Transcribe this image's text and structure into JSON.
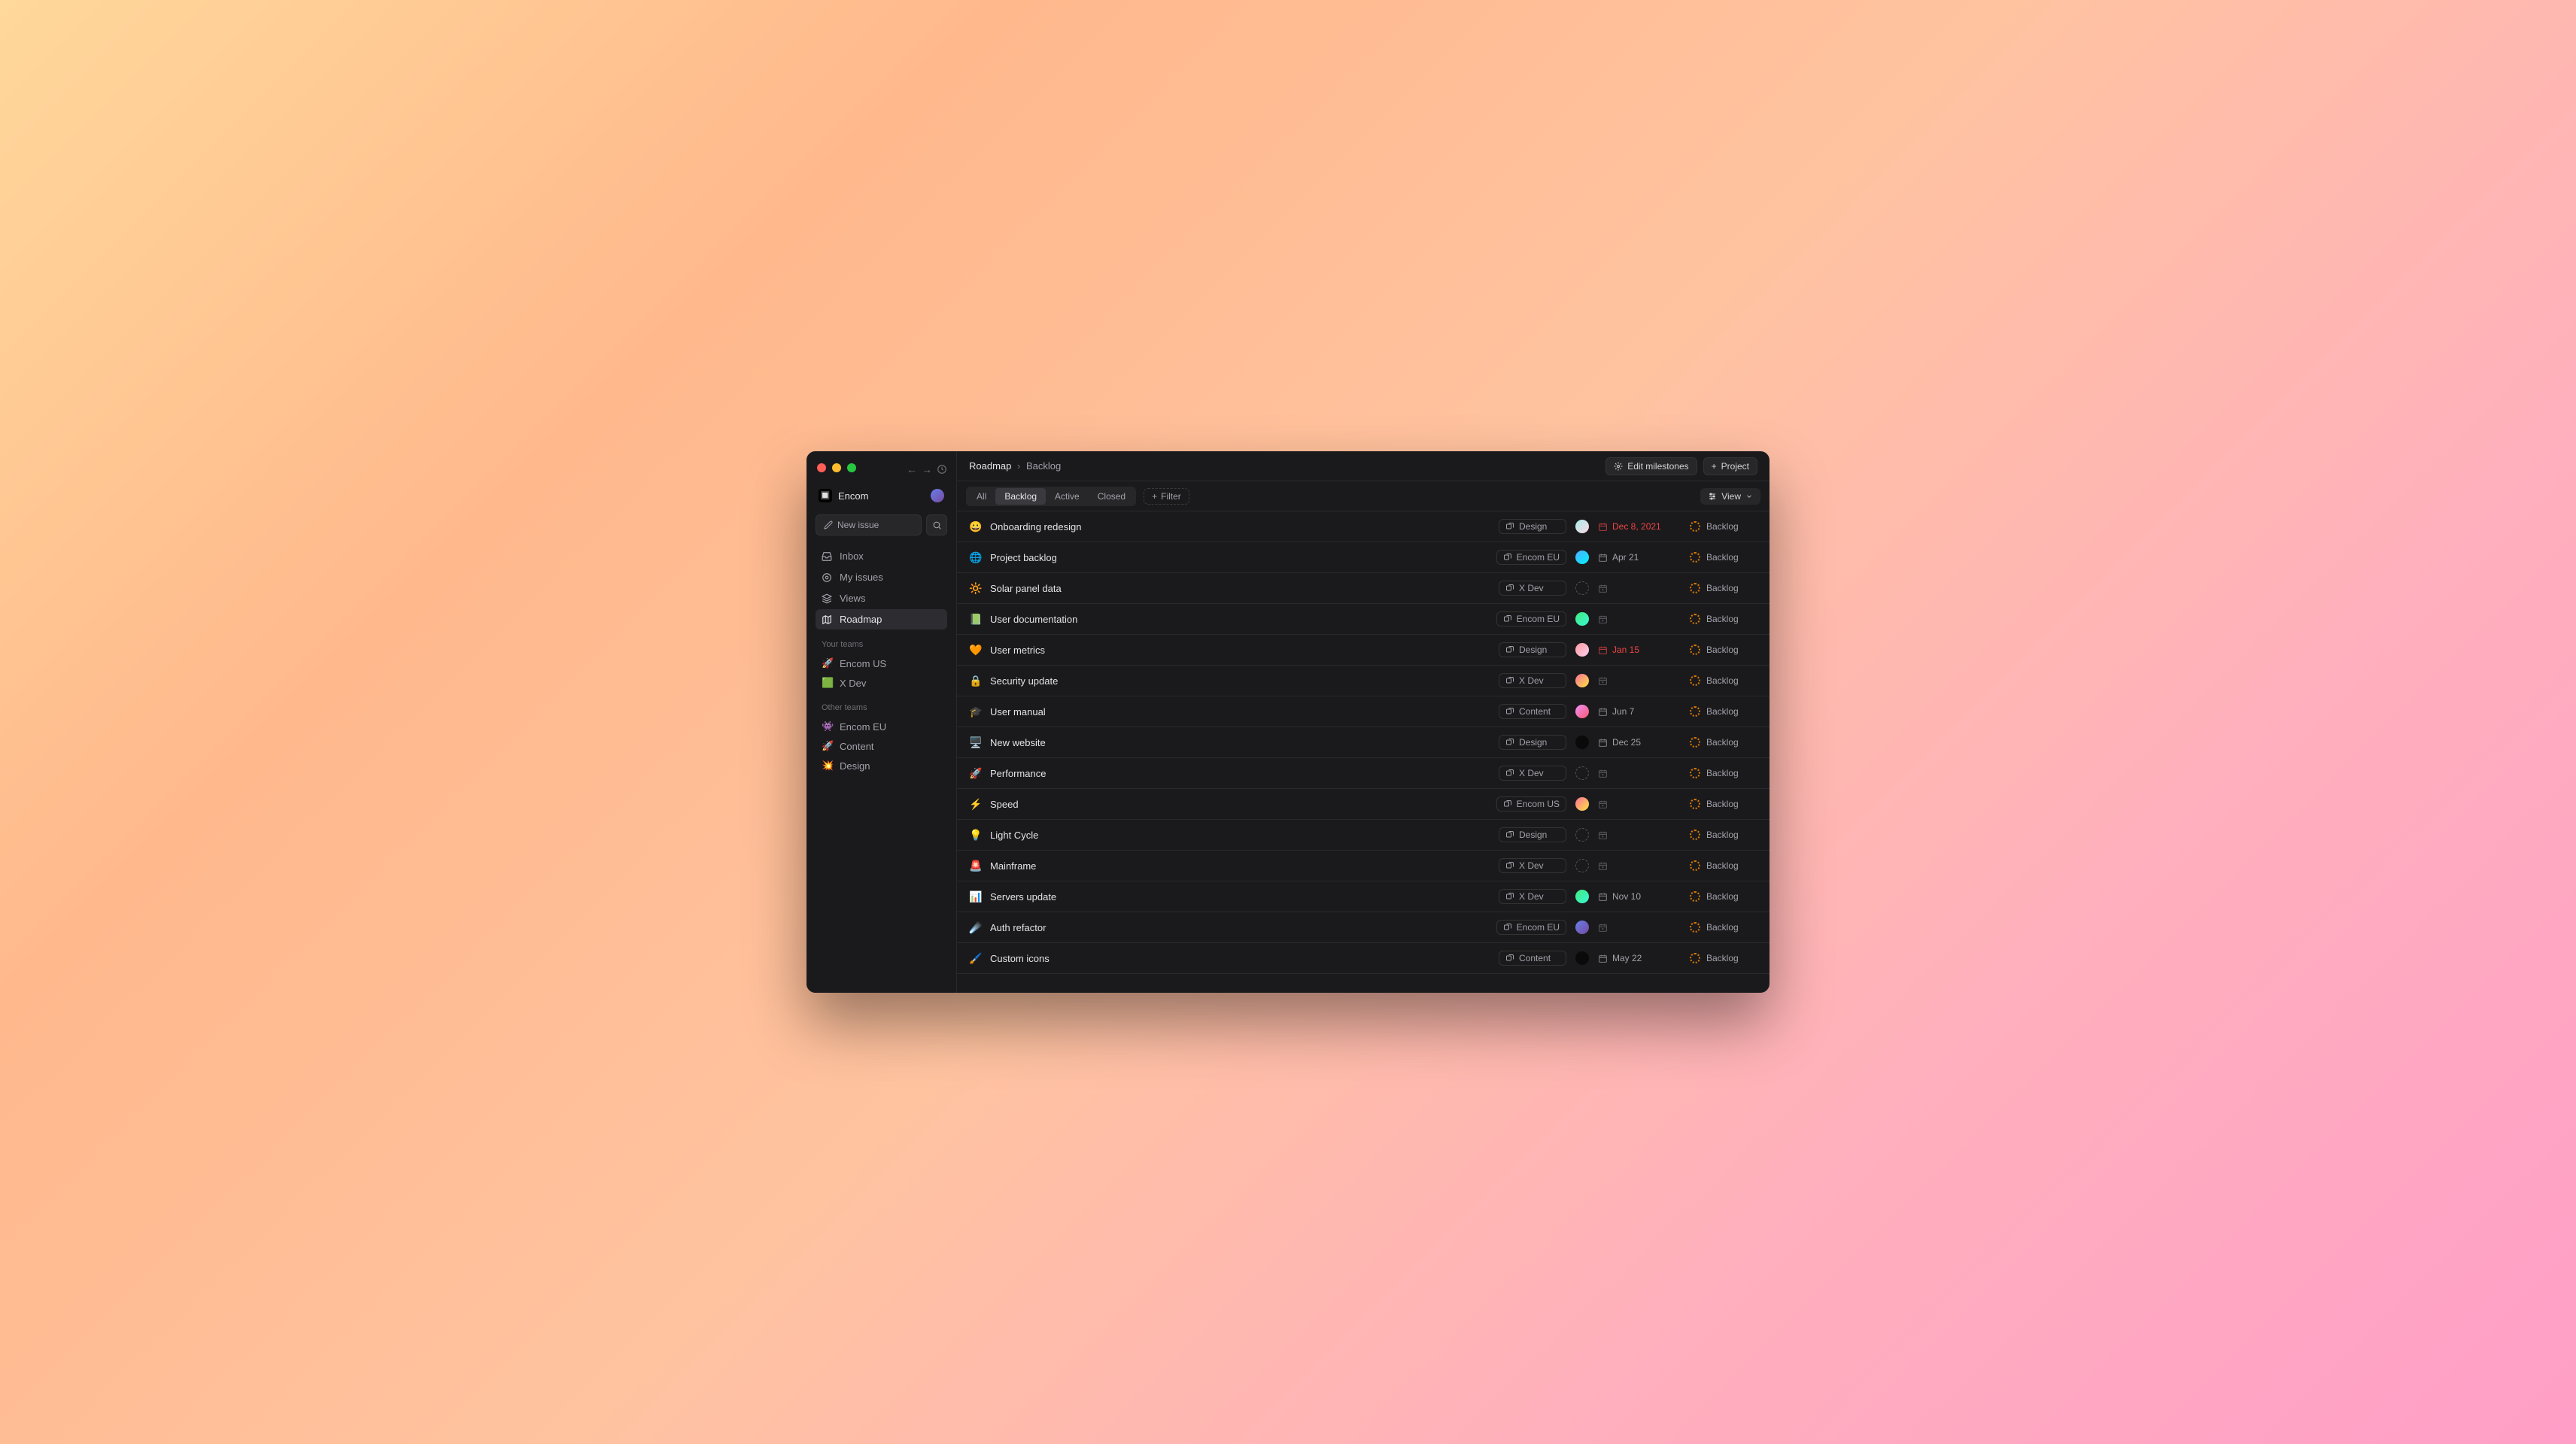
{
  "workspace": {
    "name": "Encom",
    "logo_emoji": "🔲"
  },
  "new_issue_label": "New issue",
  "nav": {
    "inbox": "Inbox",
    "my_issues": "My issues",
    "views": "Views",
    "roadmap": "Roadmap"
  },
  "sections": {
    "your_teams": "Your teams",
    "other_teams": "Other teams"
  },
  "your_teams": [
    {
      "emoji": "🚀",
      "name": "Encom US"
    },
    {
      "emoji": "🟩",
      "name": "X Dev"
    }
  ],
  "other_teams": [
    {
      "emoji": "👾",
      "name": "Encom EU"
    },
    {
      "emoji": "🚀",
      "name": "Content"
    },
    {
      "emoji": "💥",
      "name": "Design"
    }
  ],
  "breadcrumb": {
    "root": "Roadmap",
    "sep": "›",
    "current": "Backlog"
  },
  "topbar": {
    "edit_milestones": "Edit milestones",
    "project": "Project"
  },
  "tabs": {
    "all": "All",
    "backlog": "Backlog",
    "active": "Active",
    "closed": "Closed"
  },
  "filter_label": "Filter",
  "view_label": "View",
  "status_label": "Backlog",
  "issues": [
    {
      "emoji": "😀",
      "title": "Onboarding redesign",
      "team": "Design",
      "assignee": "avatar-grad-5",
      "due": "Dec 8, 2021",
      "overdue": true
    },
    {
      "emoji": "🌐",
      "title": "Project backlog",
      "team": "Encom EU",
      "assignee": "avatar-grad-2",
      "due": "Apr 21",
      "overdue": false
    },
    {
      "emoji": "🔆",
      "title": "Solar panel data",
      "team": "X Dev",
      "assignee": "",
      "due": "",
      "overdue": false
    },
    {
      "emoji": "📗",
      "title": "User documentation",
      "team": "Encom EU",
      "assignee": "avatar-grad-3",
      "due": "",
      "overdue": false
    },
    {
      "emoji": "🧡",
      "title": "User metrics",
      "team": "Design",
      "assignee": "avatar-grad-6",
      "due": "Jan 15",
      "overdue": true
    },
    {
      "emoji": "🔒",
      "title": "Security update",
      "team": "X Dev",
      "assignee": "avatar-grad-4",
      "due": "",
      "overdue": false
    },
    {
      "emoji": "🎓",
      "title": "User manual",
      "team": "Content",
      "assignee": "avatar-grad-1",
      "due": "Jun 7",
      "overdue": false
    },
    {
      "emoji": "🖥️",
      "title": "New website",
      "team": "Design",
      "assignee": "avatar-dark",
      "due": "Dec 25",
      "overdue": false
    },
    {
      "emoji": "🚀",
      "title": "Performance",
      "team": "X Dev",
      "assignee": "",
      "due": "",
      "overdue": false
    },
    {
      "emoji": "⚡",
      "title": "Speed",
      "team": "Encom US",
      "assignee": "avatar-grad-4",
      "due": "",
      "overdue": false
    },
    {
      "emoji": "💡",
      "title": "Light Cycle",
      "team": "Design",
      "assignee": "",
      "due": "",
      "overdue": false
    },
    {
      "emoji": "🚨",
      "title": "Mainframe",
      "team": "X Dev",
      "assignee": "",
      "due": "",
      "overdue": false
    },
    {
      "emoji": "📊",
      "title": "Servers update",
      "team": "X Dev",
      "assignee": "avatar-grad-3",
      "due": "Nov 10",
      "overdue": false
    },
    {
      "emoji": "☄️",
      "title": "Auth refactor",
      "team": "Encom EU",
      "assignee": "avatar-grad-7",
      "due": "",
      "overdue": false
    },
    {
      "emoji": "🖌️",
      "title": "Custom icons",
      "team": "Content",
      "assignee": "avatar-dark",
      "due": "May 22",
      "overdue": false
    }
  ]
}
